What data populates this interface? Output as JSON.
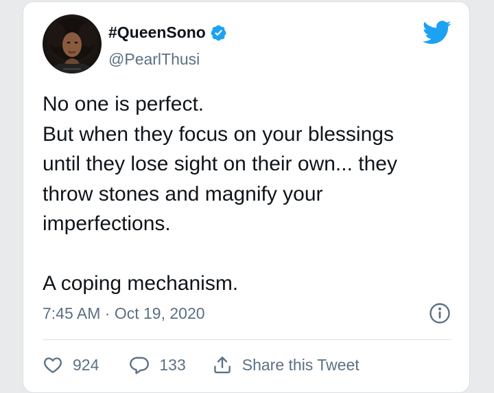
{
  "tweet": {
    "display_name": "#QueenSono",
    "handle": "@PearlThusi",
    "verified": true,
    "lines": [
      "No one is perfect.",
      "But when they focus on your blessings",
      "until they lose sight on their own... they",
      "throw stones and magnify your",
      "imperfections.",
      "",
      "A coping mechanism."
    ],
    "timestamp": "7:45 AM · Oct 19, 2020"
  },
  "actions": {
    "like_count": "924",
    "reply_count": "133",
    "share_label": "Share this Tweet"
  },
  "icons": {
    "brand": "twitter-bird-icon",
    "verified": "verified-badge-icon",
    "info": "info-icon",
    "like": "heart-icon",
    "reply": "reply-bubble-icon",
    "share": "share-icon"
  },
  "colors": {
    "brand_blue": "#1da1f2",
    "text_primary": "#0f1419",
    "text_secondary": "#5b7083",
    "border": "#dadde0",
    "background": "#e9eaeb"
  }
}
